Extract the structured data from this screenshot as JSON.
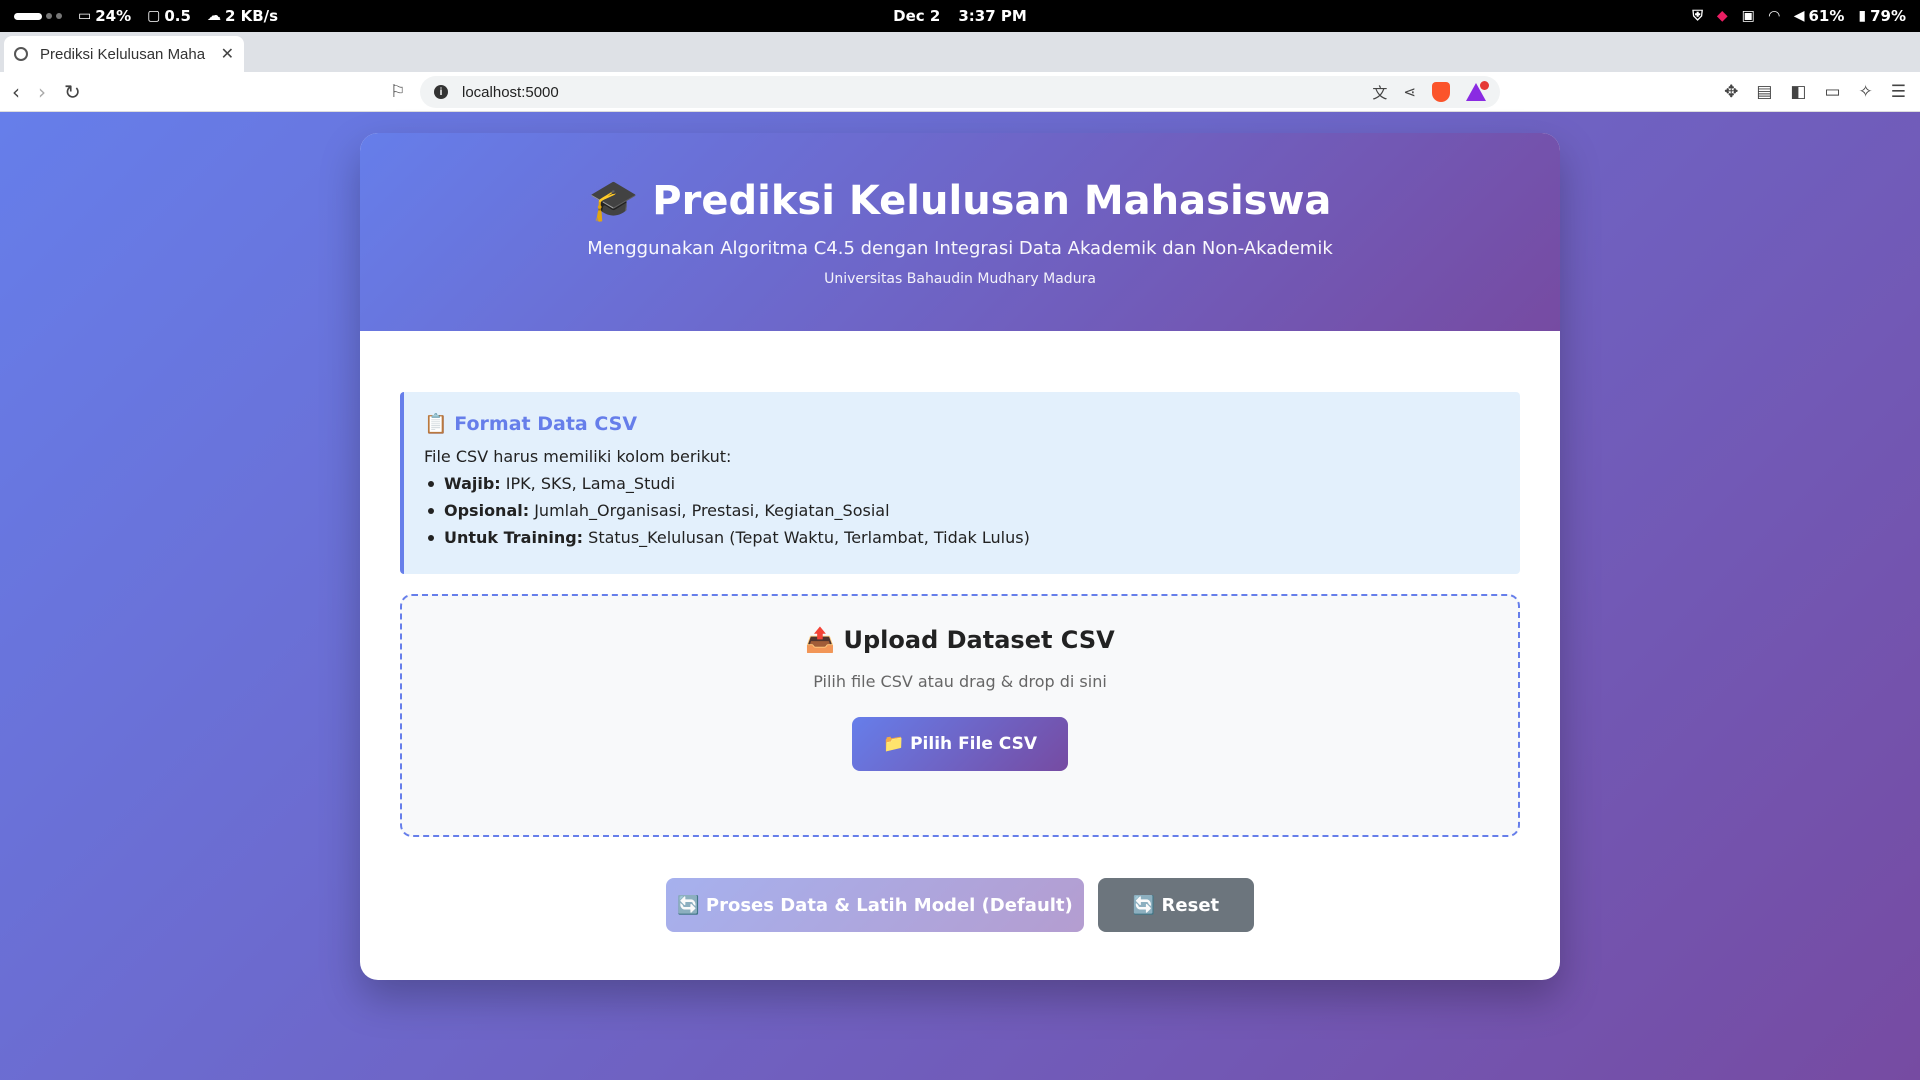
{
  "status_bar": {
    "cpu": "24%",
    "load": "0.5",
    "net": "2 KB/s",
    "date": "Dec 2",
    "time": "3:37 PM",
    "volume": "61%",
    "battery": "79%"
  },
  "browser": {
    "tab_title": "Prediksi Kelulusan Maha",
    "url": "localhost:5000"
  },
  "header": {
    "title": "🎓 Prediksi Kelulusan Mahasiswa",
    "subtitle": "Menggunakan Algoritma C4.5 dengan Integrasi Data Akademik dan Non-Akademik",
    "university": "Universitas Bahaudin Mudhary Madura"
  },
  "format_info": {
    "heading": "📋 Format Data CSV",
    "intro": "File CSV harus memiliki kolom berikut:",
    "items": [
      {
        "label": "Wajib:",
        "value": " IPK, SKS, Lama_Studi"
      },
      {
        "label": "Opsional:",
        "value": " Jumlah_Organisasi, Prestasi, Kegiatan_Sosial"
      },
      {
        "label": "Untuk Training:",
        "value": " Status_Kelulusan (Tepat Waktu, Terlambat, Tidak Lulus)"
      }
    ]
  },
  "upload": {
    "heading": "📤 Upload Dataset CSV",
    "hint": "Pilih file CSV atau drag & drop di sini",
    "button": "📁 Pilih File CSV"
  },
  "actions": {
    "process": "🔄 Proses Data & Latih Model (Default)",
    "reset": "🔄 Reset"
  },
  "colors": {
    "gradient_start": "#667eea",
    "gradient_end": "#764ba2",
    "info_bg": "#e3f0fc",
    "reset_bg": "#6c757d"
  }
}
